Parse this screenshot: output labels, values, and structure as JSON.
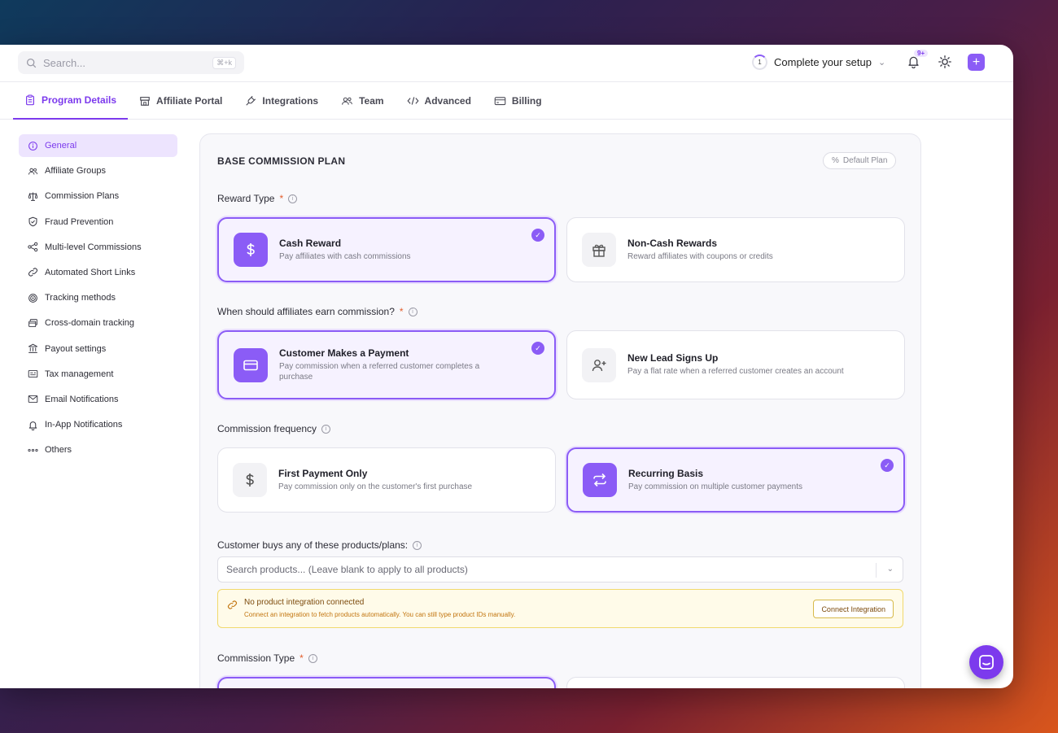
{
  "topbar": {
    "search_placeholder": "Search...",
    "search_shortcut": "⌘+k",
    "setup_step": "1",
    "setup_label": "Complete your setup",
    "notifications_badge": "9+"
  },
  "tabs": [
    {
      "label": "Program Details",
      "icon": "clipboard-icon",
      "active": true
    },
    {
      "label": "Affiliate Portal",
      "icon": "store-icon"
    },
    {
      "label": "Integrations",
      "icon": "plug-icon"
    },
    {
      "label": "Team",
      "icon": "users-icon"
    },
    {
      "label": "Advanced",
      "icon": "code-icon"
    },
    {
      "label": "Billing",
      "icon": "credit-card-icon"
    }
  ],
  "sidebar": {
    "items": [
      {
        "label": "General",
        "icon": "info-icon",
        "active": true
      },
      {
        "label": "Affiliate Groups",
        "icon": "users-icon"
      },
      {
        "label": "Commission Plans",
        "icon": "scale-icon"
      },
      {
        "label": "Fraud Prevention",
        "icon": "shield-icon"
      },
      {
        "label": "Multi-level Commissions",
        "icon": "network-icon"
      },
      {
        "label": "Automated Short Links",
        "icon": "link-icon"
      },
      {
        "label": "Tracking methods",
        "icon": "target-icon"
      },
      {
        "label": "Cross-domain tracking",
        "icon": "windows-icon"
      },
      {
        "label": "Payout settings",
        "icon": "bank-icon"
      },
      {
        "label": "Tax management",
        "icon": "receipt-icon"
      },
      {
        "label": "Email Notifications",
        "icon": "mail-icon"
      },
      {
        "label": "In-App Notifications",
        "icon": "bell-icon"
      },
      {
        "label": "Others",
        "icon": "dots-icon"
      }
    ]
  },
  "plan": {
    "title": "BASE COMMISSION PLAN",
    "default_badge": "Default Plan",
    "reward_type_label": "Reward Type",
    "reward_options": [
      {
        "title": "Cash Reward",
        "desc": "Pay affiliates with cash commissions",
        "selected": true
      },
      {
        "title": "Non-Cash Rewards",
        "desc": "Reward affiliates with coupons or credits",
        "selected": false
      }
    ],
    "earn_label": "When should affiliates earn commission?",
    "earn_options": [
      {
        "title": "Customer Makes a Payment",
        "desc": "Pay commission when a referred customer completes a purchase",
        "selected": true
      },
      {
        "title": "New Lead Signs Up",
        "desc": "Pay a flat rate when a referred customer creates an account",
        "selected": false
      }
    ],
    "frequency_label": "Commission frequency",
    "frequency_options": [
      {
        "title": "First Payment Only",
        "desc": "Pay commission only on the customer's first purchase",
        "selected": false
      },
      {
        "title": "Recurring Basis",
        "desc": "Pay commission on multiple customer payments",
        "selected": true
      }
    ],
    "products_label": "Customer buys any of these products/plans:",
    "products_placeholder": "Search products... (Leave blank to apply to all products)",
    "alert": {
      "title": "No product integration connected",
      "desc": "Connect an integration to fetch products automatically. You can still type product IDs manually.",
      "button": "Connect Integration"
    },
    "commission_type_label": "Commission Type",
    "required_mark": "*"
  },
  "colors": {
    "accent": "#8b5cf6",
    "accent_dark": "#7c3aed",
    "warning_bg": "#fffbe9"
  }
}
